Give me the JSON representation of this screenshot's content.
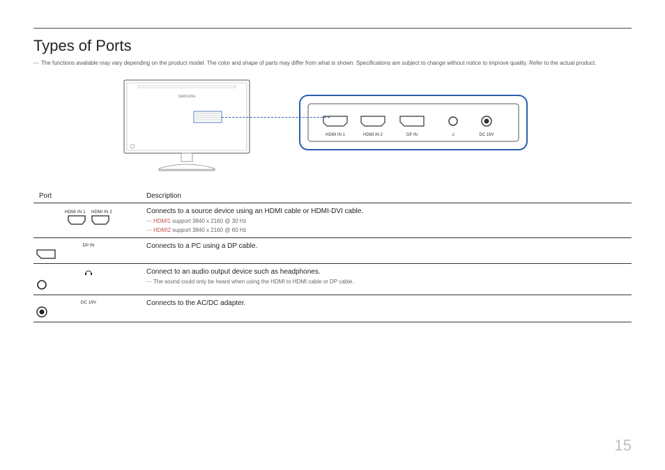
{
  "title": "Types of Ports",
  "disclaimer": "The functions available may vary depending on the product model. The color and shape of parts may differ from what is shown. Specifications are subject to change without notice to improve quality. Refer to the actual product.",
  "zoom_labels": {
    "hdmi1": "HDMI IN 1",
    "hdmi2": "HDMI IN 2",
    "dp": "DP IN",
    "hp": "∩",
    "dc": "DC 19V"
  },
  "table": {
    "col_port": "Port",
    "col_desc": "Description",
    "rows": [
      {
        "labels": [
          "HDMI IN 1",
          "HDMI IN 2"
        ],
        "desc": "Connects to a source device using an HDMI cable or HDMI-DVI cable.",
        "subs": [
          {
            "kw": "HDMI1",
            "text": " support 3840 x 2160 @ 30 Hz"
          },
          {
            "kw": "HDMI2",
            "text": " support 3840 x 2160 @ 60 Hz"
          }
        ],
        "icon": "hdmi-pair"
      },
      {
        "labels": [
          "DP IN"
        ],
        "desc": "Connects to a PC using a DP cable.",
        "icon": "dp"
      },
      {
        "labels": [
          "∩"
        ],
        "desc": "Connect to an audio output device such as headphones.",
        "subs": [
          {
            "kw": "",
            "text": "The sound could only be heard when using the HDMI to HDMI cable or DP cable."
          }
        ],
        "icon": "jack"
      },
      {
        "labels": [
          "DC 19V"
        ],
        "desc": "Connects to the AC/DC adapter.",
        "icon": "dc"
      }
    ]
  },
  "brand": "SAMSUNG",
  "page_number": "15"
}
